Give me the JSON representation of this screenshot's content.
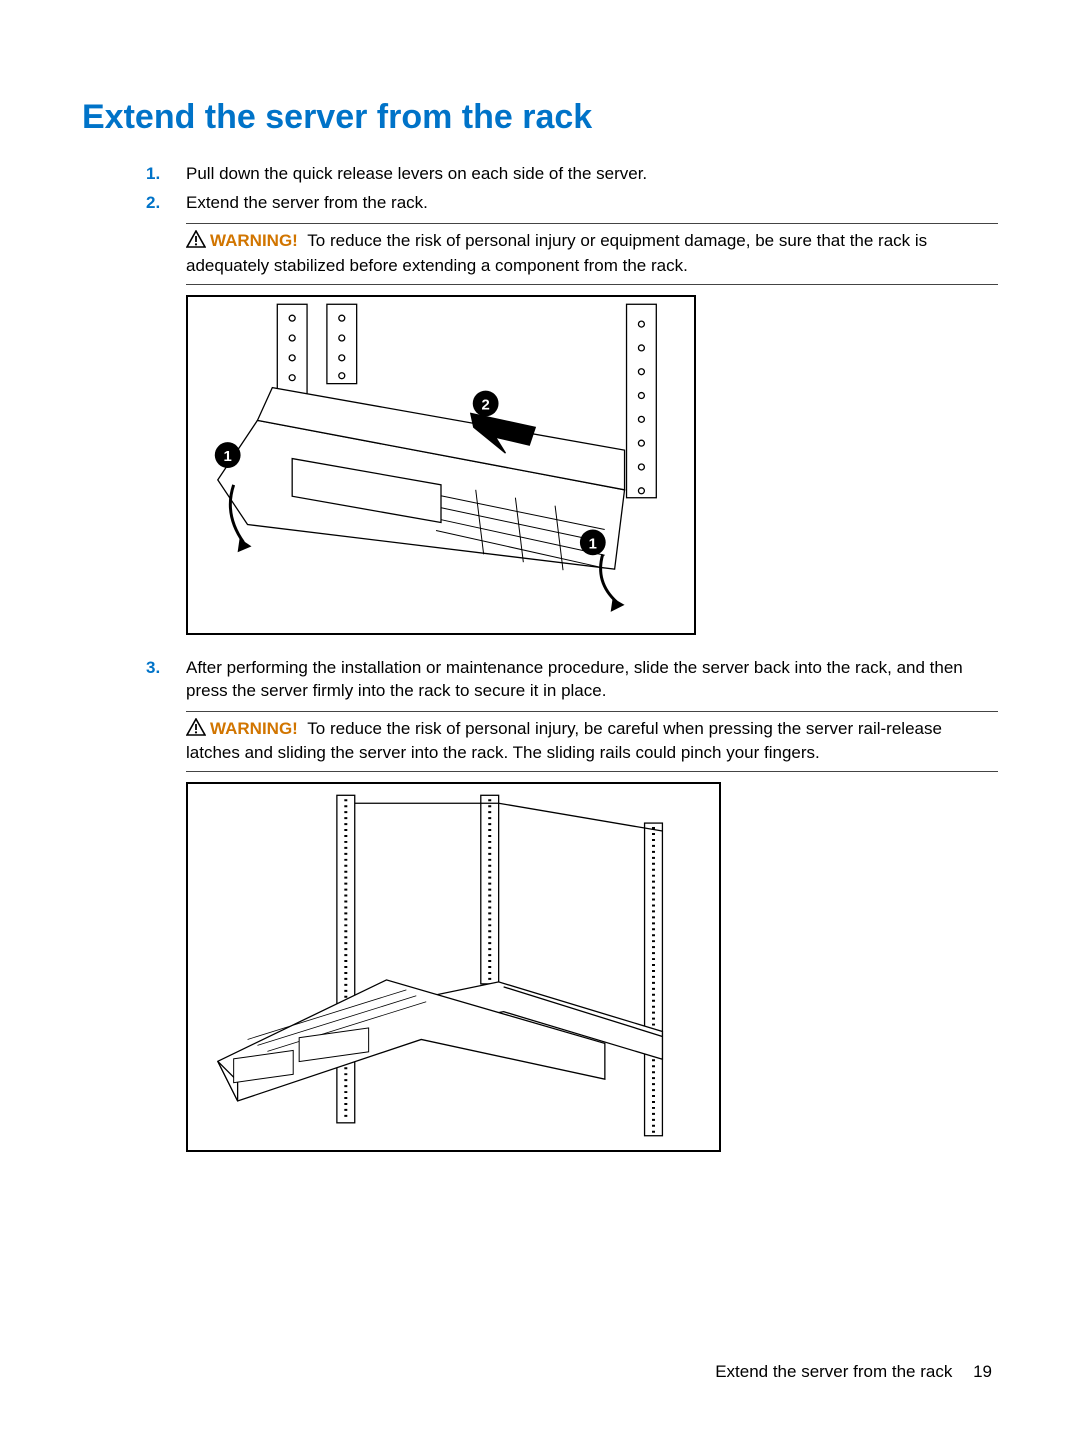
{
  "title": "Extend the server from the rack",
  "steps": {
    "s1": {
      "num": "1.",
      "text": "Pull down the quick release levers on each side of the server."
    },
    "s2": {
      "num": "2.",
      "text": "Extend the server from the rack."
    },
    "s3": {
      "num": "3.",
      "text": "After performing the installation or maintenance procedure, slide the server back into the rack, and then press the server firmly into the rack to secure it in place."
    }
  },
  "warnings": {
    "w1": {
      "label": "WARNING!",
      "text": "To reduce the risk of personal injury or equipment damage, be sure that the rack is adequately stabilized before extending a component from the rack."
    },
    "w2": {
      "label": "WARNING!",
      "text": "To reduce the risk of personal injury, be careful when pressing the server rail-release latches and sliding the server into the rack. The sliding rails could pinch your fingers."
    }
  },
  "figures": {
    "f1": {
      "alt": "Diagram: pulling quick-release levers and extending server from rack",
      "callouts": [
        "1",
        "2",
        "1"
      ]
    },
    "f2": {
      "alt": "Diagram: sliding the server back into the rack on rails"
    }
  },
  "footer": {
    "section": "Extend the server from the rack",
    "page": "19"
  }
}
